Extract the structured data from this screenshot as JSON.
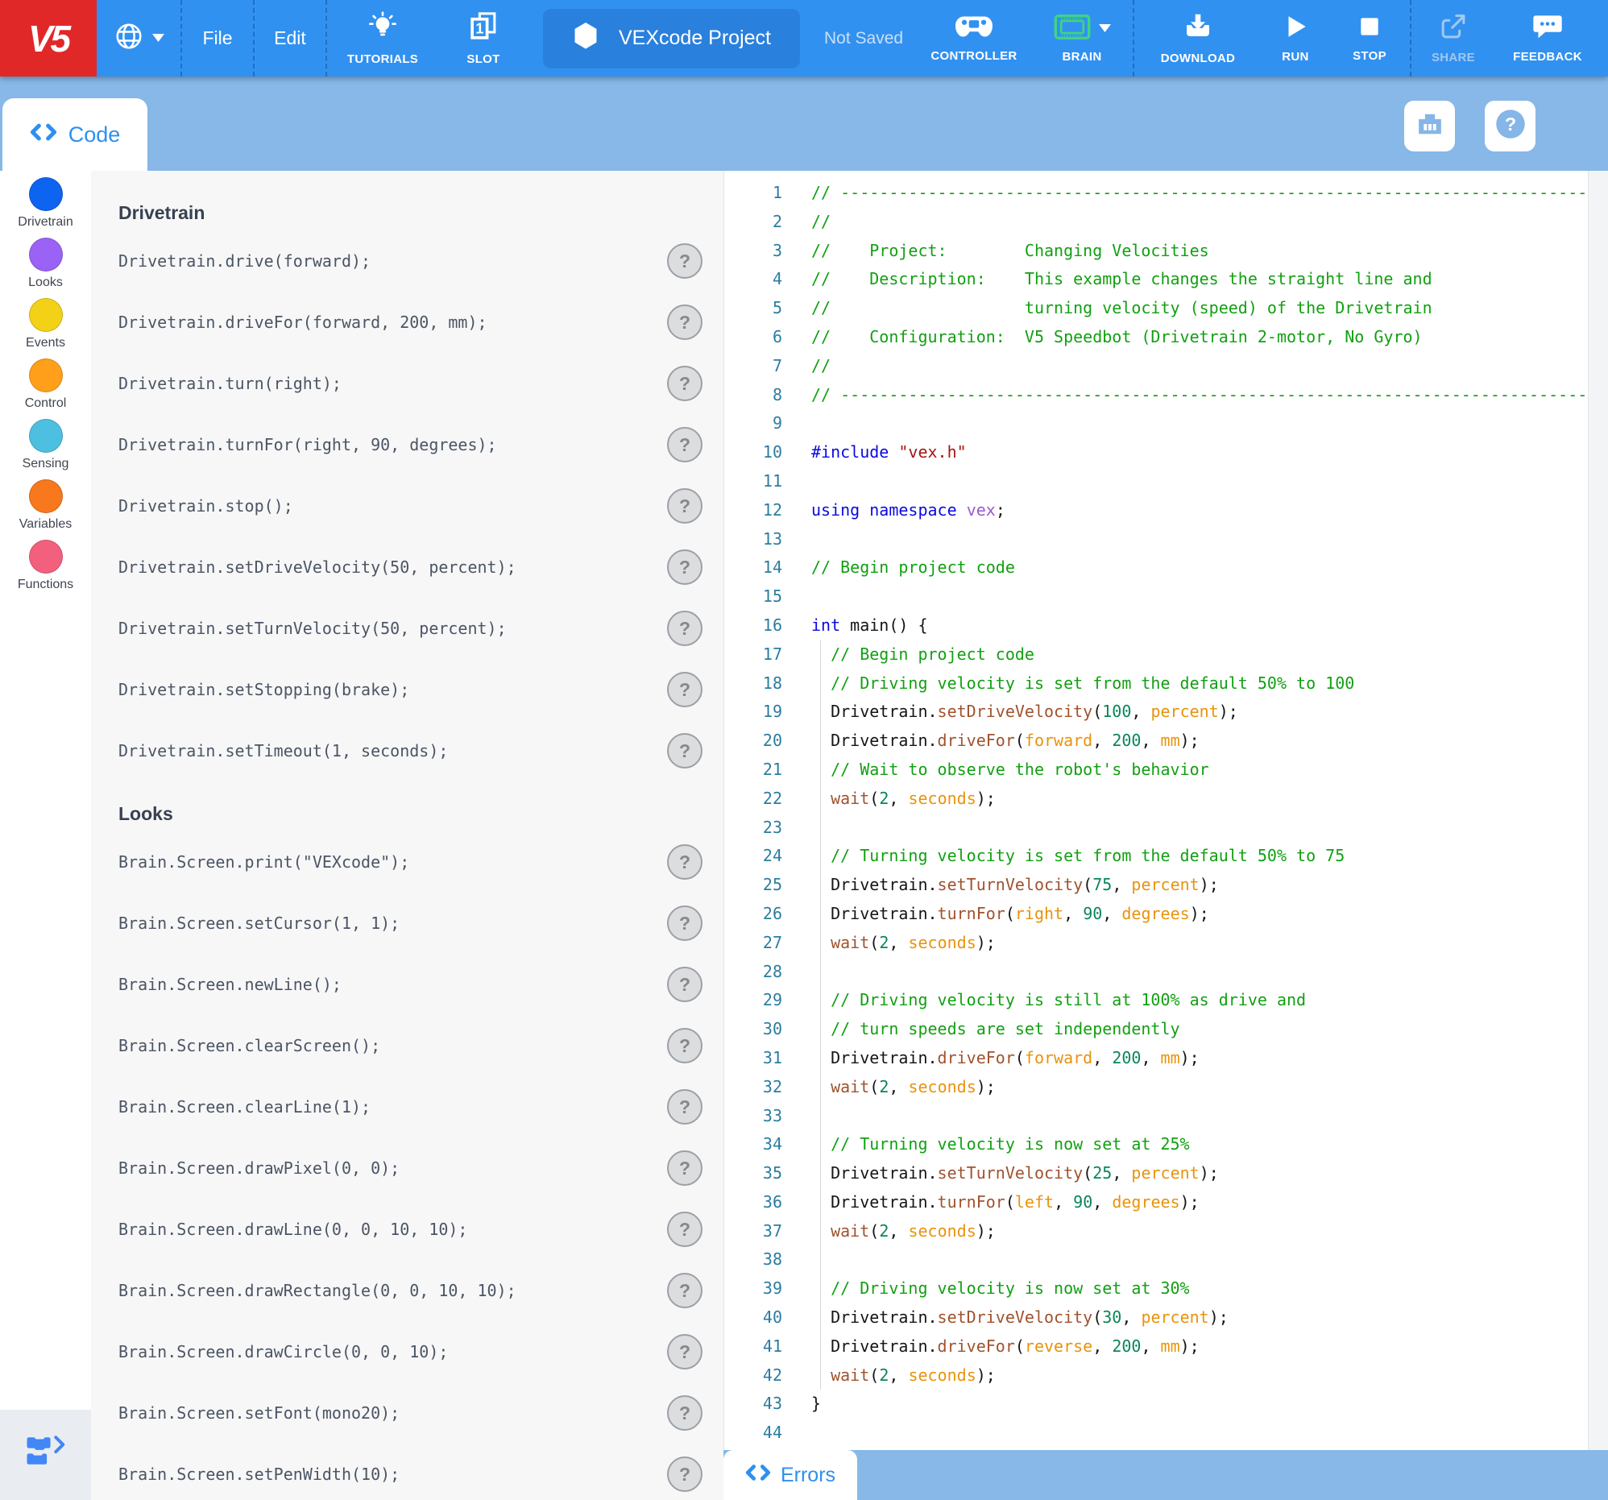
{
  "header": {
    "logo_text": "V5",
    "menu": {
      "file": "File",
      "edit": "Edit"
    },
    "tutorials_label": "TUTORIALS",
    "slot_label": "SLOT",
    "slot_number": "1",
    "project_name": "VEXcode Project",
    "save_status": "Not Saved",
    "controller_label": "CONTROLLER",
    "brain_label": "BRAIN",
    "download_label": "DOWNLOAD",
    "run_label": "RUN",
    "stop_label": "STOP",
    "share_label": "SHARE",
    "feedback_label": "FEEDBACK"
  },
  "tabs": {
    "code": "Code",
    "errors": "Errors"
  },
  "sidebar": {
    "items": [
      {
        "label": "Drivetrain",
        "color": "#0d64f0"
      },
      {
        "label": "Looks",
        "color": "#9a63f5"
      },
      {
        "label": "Events",
        "color": "#f2d117"
      },
      {
        "label": "Control",
        "color": "#ff9f1a"
      },
      {
        "label": "Sensing",
        "color": "#4dbfe0"
      },
      {
        "label": "Variables",
        "color": "#f8781d"
      },
      {
        "label": "Functions",
        "color": "#f2607e"
      }
    ]
  },
  "palette": {
    "help_glyph": "?",
    "sections": [
      {
        "title": "Drivetrain",
        "items": [
          "Drivetrain.drive(forward);",
          "Drivetrain.driveFor(forward, 200, mm);",
          "Drivetrain.turn(right);",
          "Drivetrain.turnFor(right, 90, degrees);",
          "Drivetrain.stop();",
          "Drivetrain.setDriveVelocity(50, percent);",
          "Drivetrain.setTurnVelocity(50, percent);",
          "Drivetrain.setStopping(brake);",
          "Drivetrain.setTimeout(1, seconds);"
        ]
      },
      {
        "title": "Looks",
        "items": [
          "Brain.Screen.print(\"VEXcode\");",
          "Brain.Screen.setCursor(1, 1);",
          "Brain.Screen.newLine();",
          "Brain.Screen.clearScreen();",
          "Brain.Screen.clearLine(1);",
          "Brain.Screen.drawPixel(0, 0);",
          "Brain.Screen.drawLine(0, 0, 10, 10);",
          "Brain.Screen.drawRectangle(0, 0, 10, 10);",
          "Brain.Screen.drawCircle(0, 0, 10);",
          "Brain.Screen.setFont(mono20);",
          "Brain.Screen.setPenWidth(10);"
        ]
      }
    ]
  },
  "editor": {
    "lines": [
      {
        "n": 1,
        "t": [
          [
            "c",
            "// --------------------------------------------------------------------------------------------------------------"
          ]
        ]
      },
      {
        "n": 2,
        "t": [
          [
            "c",
            "//"
          ]
        ]
      },
      {
        "n": 3,
        "t": [
          [
            "c",
            "//    Project:        Changing Velocities"
          ]
        ]
      },
      {
        "n": 4,
        "t": [
          [
            "c",
            "//    Description:    This example changes the straight line and"
          ]
        ]
      },
      {
        "n": 5,
        "t": [
          [
            "c",
            "//                    turning velocity (speed) of the Drivetrain"
          ]
        ]
      },
      {
        "n": 6,
        "t": [
          [
            "c",
            "//    Configuration:  V5 Speedbot (Drivetrain 2-motor, No Gyro)"
          ]
        ]
      },
      {
        "n": 7,
        "t": [
          [
            "c",
            "//"
          ]
        ]
      },
      {
        "n": 8,
        "t": [
          [
            "c",
            "// --------------------------------------------------------------------------------------------------------------"
          ]
        ]
      },
      {
        "n": 9,
        "t": []
      },
      {
        "n": 10,
        "t": [
          [
            "k",
            "#include"
          ],
          [
            "p",
            " "
          ],
          [
            "s",
            "\"vex.h\""
          ]
        ]
      },
      {
        "n": 11,
        "t": []
      },
      {
        "n": 12,
        "t": [
          [
            "k",
            "using"
          ],
          [
            "p",
            " "
          ],
          [
            "k",
            "namespace"
          ],
          [
            "p",
            " "
          ],
          [
            "ns",
            "vex"
          ],
          [
            "p",
            ";"
          ]
        ]
      },
      {
        "n": 13,
        "t": []
      },
      {
        "n": 14,
        "t": [
          [
            "c",
            "// Begin project code"
          ]
        ]
      },
      {
        "n": 15,
        "t": []
      },
      {
        "n": 16,
        "t": [
          [
            "k",
            "int"
          ],
          [
            "p",
            " main() {"
          ]
        ]
      },
      {
        "n": 17,
        "g": true,
        "t": [
          [
            "c",
            "  // Begin project code"
          ]
        ]
      },
      {
        "n": 18,
        "g": true,
        "t": [
          [
            "c",
            "  // Driving velocity is set from the default 50% to 100"
          ]
        ]
      },
      {
        "n": 19,
        "g": true,
        "t": [
          [
            "p",
            "  Drivetrain."
          ],
          [
            "f",
            "setDriveVelocity"
          ],
          [
            "p",
            "("
          ],
          [
            "d",
            "100"
          ],
          [
            "p",
            ", "
          ],
          [
            "e",
            "percent"
          ],
          [
            "p",
            ");"
          ]
        ]
      },
      {
        "n": 20,
        "g": true,
        "t": [
          [
            "p",
            "  Drivetrain."
          ],
          [
            "f",
            "driveFor"
          ],
          [
            "p",
            "("
          ],
          [
            "e",
            "forward"
          ],
          [
            "p",
            ", "
          ],
          [
            "d",
            "200"
          ],
          [
            "p",
            ", "
          ],
          [
            "e",
            "mm"
          ],
          [
            "p",
            ");"
          ]
        ]
      },
      {
        "n": 21,
        "g": true,
        "t": [
          [
            "c",
            "  // Wait to observe the robot's behavior"
          ]
        ]
      },
      {
        "n": 22,
        "g": true,
        "t": [
          [
            "p",
            "  "
          ],
          [
            "f",
            "wait"
          ],
          [
            "p",
            "("
          ],
          [
            "d",
            "2"
          ],
          [
            "p",
            ", "
          ],
          [
            "e",
            "seconds"
          ],
          [
            "p",
            ");"
          ]
        ]
      },
      {
        "n": 23,
        "g": true,
        "t": []
      },
      {
        "n": 24,
        "g": true,
        "t": [
          [
            "c",
            "  // Turning velocity is set from the default 50% to 75"
          ]
        ]
      },
      {
        "n": 25,
        "g": true,
        "t": [
          [
            "p",
            "  Drivetrain."
          ],
          [
            "f",
            "setTurnVelocity"
          ],
          [
            "p",
            "("
          ],
          [
            "d",
            "75"
          ],
          [
            "p",
            ", "
          ],
          [
            "e",
            "percent"
          ],
          [
            "p",
            ");"
          ]
        ]
      },
      {
        "n": 26,
        "g": true,
        "t": [
          [
            "p",
            "  Drivetrain."
          ],
          [
            "f",
            "turnFor"
          ],
          [
            "p",
            "("
          ],
          [
            "e",
            "right"
          ],
          [
            "p",
            ", "
          ],
          [
            "d",
            "90"
          ],
          [
            "p",
            ", "
          ],
          [
            "e",
            "degrees"
          ],
          [
            "p",
            ");"
          ]
        ]
      },
      {
        "n": 27,
        "g": true,
        "t": [
          [
            "p",
            "  "
          ],
          [
            "f",
            "wait"
          ],
          [
            "p",
            "("
          ],
          [
            "d",
            "2"
          ],
          [
            "p",
            ", "
          ],
          [
            "e",
            "seconds"
          ],
          [
            "p",
            ");"
          ]
        ]
      },
      {
        "n": 28,
        "g": true,
        "t": []
      },
      {
        "n": 29,
        "g": true,
        "t": [
          [
            "c",
            "  // Driving velocity is still at 100% as drive and"
          ]
        ]
      },
      {
        "n": 30,
        "g": true,
        "t": [
          [
            "c",
            "  // turn speeds are set independently"
          ]
        ]
      },
      {
        "n": 31,
        "g": true,
        "t": [
          [
            "p",
            "  Drivetrain."
          ],
          [
            "f",
            "driveFor"
          ],
          [
            "p",
            "("
          ],
          [
            "e",
            "forward"
          ],
          [
            "p",
            ", "
          ],
          [
            "d",
            "200"
          ],
          [
            "p",
            ", "
          ],
          [
            "e",
            "mm"
          ],
          [
            "p",
            ");"
          ]
        ]
      },
      {
        "n": 32,
        "g": true,
        "t": [
          [
            "p",
            "  "
          ],
          [
            "f",
            "wait"
          ],
          [
            "p",
            "("
          ],
          [
            "d",
            "2"
          ],
          [
            "p",
            ", "
          ],
          [
            "e",
            "seconds"
          ],
          [
            "p",
            ");"
          ]
        ]
      },
      {
        "n": 33,
        "g": true,
        "t": []
      },
      {
        "n": 34,
        "g": true,
        "t": [
          [
            "c",
            "  // Turning velocity is now set at 25%"
          ]
        ]
      },
      {
        "n": 35,
        "g": true,
        "t": [
          [
            "p",
            "  Drivetrain."
          ],
          [
            "f",
            "setTurnVelocity"
          ],
          [
            "p",
            "("
          ],
          [
            "d",
            "25"
          ],
          [
            "p",
            ", "
          ],
          [
            "e",
            "percent"
          ],
          [
            "p",
            ");"
          ]
        ]
      },
      {
        "n": 36,
        "g": true,
        "t": [
          [
            "p",
            "  Drivetrain."
          ],
          [
            "f",
            "turnFor"
          ],
          [
            "p",
            "("
          ],
          [
            "e",
            "left"
          ],
          [
            "p",
            ", "
          ],
          [
            "d",
            "90"
          ],
          [
            "p",
            ", "
          ],
          [
            "e",
            "degrees"
          ],
          [
            "p",
            ");"
          ]
        ]
      },
      {
        "n": 37,
        "g": true,
        "t": [
          [
            "p",
            "  "
          ],
          [
            "f",
            "wait"
          ],
          [
            "p",
            "("
          ],
          [
            "d",
            "2"
          ],
          [
            "p",
            ", "
          ],
          [
            "e",
            "seconds"
          ],
          [
            "p",
            ");"
          ]
        ]
      },
      {
        "n": 38,
        "g": true,
        "t": []
      },
      {
        "n": 39,
        "g": true,
        "t": [
          [
            "c",
            "  // Driving velocity is now set at 30%"
          ]
        ]
      },
      {
        "n": 40,
        "g": true,
        "t": [
          [
            "p",
            "  Drivetrain."
          ],
          [
            "f",
            "setDriveVelocity"
          ],
          [
            "p",
            "("
          ],
          [
            "d",
            "30"
          ],
          [
            "p",
            ", "
          ],
          [
            "e",
            "percent"
          ],
          [
            "p",
            ");"
          ]
        ]
      },
      {
        "n": 41,
        "g": true,
        "t": [
          [
            "p",
            "  Drivetrain."
          ],
          [
            "f",
            "driveFor"
          ],
          [
            "p",
            "("
          ],
          [
            "e",
            "reverse"
          ],
          [
            "p",
            ", "
          ],
          [
            "d",
            "200"
          ],
          [
            "p",
            ", "
          ],
          [
            "e",
            "mm"
          ],
          [
            "p",
            ");"
          ]
        ]
      },
      {
        "n": 42,
        "g": true,
        "t": [
          [
            "p",
            "  "
          ],
          [
            "f",
            "wait"
          ],
          [
            "p",
            "("
          ],
          [
            "d",
            "2"
          ],
          [
            "p",
            ", "
          ],
          [
            "e",
            "seconds"
          ],
          [
            "p",
            ");"
          ]
        ]
      },
      {
        "n": 43,
        "t": [
          [
            "p",
            "}"
          ]
        ]
      },
      {
        "n": 44,
        "t": []
      }
    ]
  },
  "colors": {
    "toolbar_blue": "#3191f0",
    "logo_red": "#e12828",
    "accent_blue": "#2e8ff0",
    "brain_green": "#3ed483",
    "strip_blue": "#87b8e7"
  }
}
